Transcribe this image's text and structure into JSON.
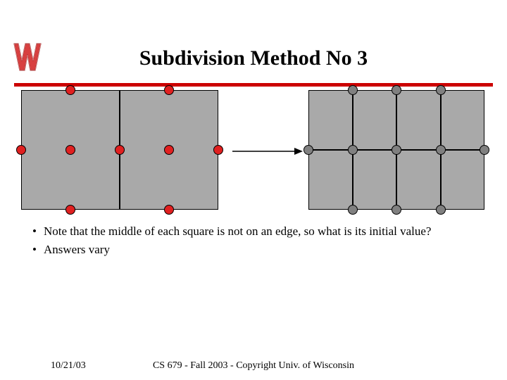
{
  "title": "Subdivision Method No 3",
  "bullets": [
    "Note that the middle of each square is not on an edge, so what is its initial value?",
    "Answers vary"
  ],
  "footer": {
    "date": "10/21/03",
    "course": "CS 679 - Fall 2003 - Copyright Univ. of Wisconsin"
  },
  "logo_alt": "wisconsin-w-logo"
}
